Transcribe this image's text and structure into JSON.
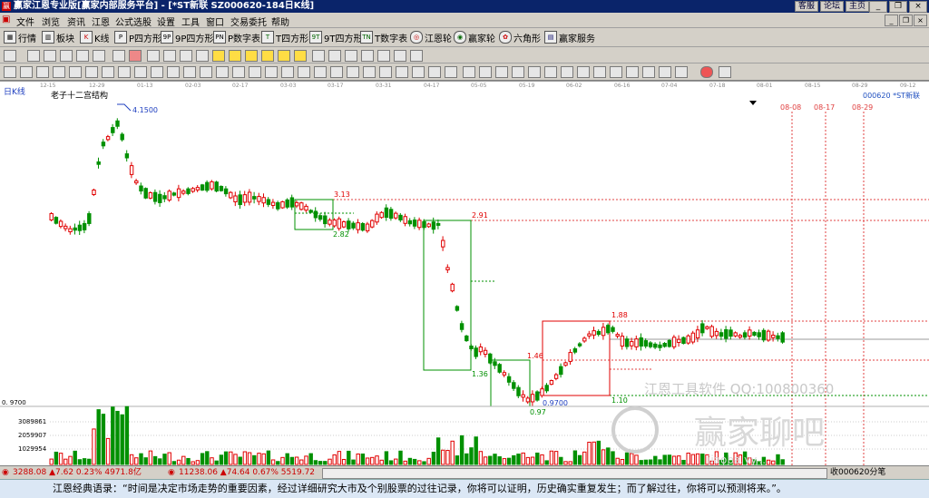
{
  "window": {
    "title": "赢家江恩专业版[赢家内部服务平台] - [*ST新联  SZ000620-184日K线]",
    "links": [
      "客服",
      "论坛",
      "主页"
    ]
  },
  "menu": [
    "文件",
    "浏览",
    "资讯",
    "江恩",
    "公式选股",
    "设置",
    "工具",
    "窗口",
    "交易委托",
    "帮助"
  ],
  "toolbar1": [
    "行情",
    "板块",
    "K线",
    "P四方形",
    "9P四方形",
    "P数字表",
    "T四方形",
    "9T四方形",
    "T数字表",
    "江恩轮",
    "赢家轮",
    "六角形",
    "赢家服务"
  ],
  "chart": {
    "period_label": "日K线",
    "study_label": "老子十二宫结构",
    "stock_label": "000620 *ST新联",
    "date_ticks": [
      "12-15",
      "12-29",
      "01-13",
      "02-03",
      "02-17",
      "03-03",
      "03-17",
      "03-31",
      "04-17",
      "05-05",
      "05-19",
      "06-02",
      "06-16",
      "07-04",
      "07-18",
      "08-01",
      "08-15",
      "08-29",
      "09-12"
    ],
    "future_dates": [
      "08-08",
      "08-17",
      "08-29"
    ],
    "price_labels": [
      "4.1500",
      "3.13",
      "2.82",
      "2.91",
      "1.88",
      "1.46",
      "1.36",
      "0.9700",
      "0.97",
      "1.10"
    ],
    "axis_low": "0. 9700",
    "volume_ticks": [
      "3089861",
      "2059907",
      "1029954"
    ],
    "watermark1": "江恩工具软件  QQ:100800360",
    "watermark2": "赢家聊吧",
    "watermark3": "jiaoba.yy..."
  },
  "status": {
    "sh": "3288.08 ▲7.62 0.23% 4971.8亿",
    "sz": "11238.06 ▲74.64 0.67% 5519.72",
    "right": "收000620分笔"
  },
  "bottom": {
    "quote": "江恩经典语录：“时间是决定市场走势的重要因素，经过详细研究大市及个别股票的过往记录，你将可以证明，历史确实重复发生；而了解过往，你将可以预测将来。”。"
  },
  "colors": {
    "up": "#e00000",
    "down": "#009000",
    "box_red": "#e00000",
    "box_green": "#009000",
    "date_line": "#e04040"
  }
}
